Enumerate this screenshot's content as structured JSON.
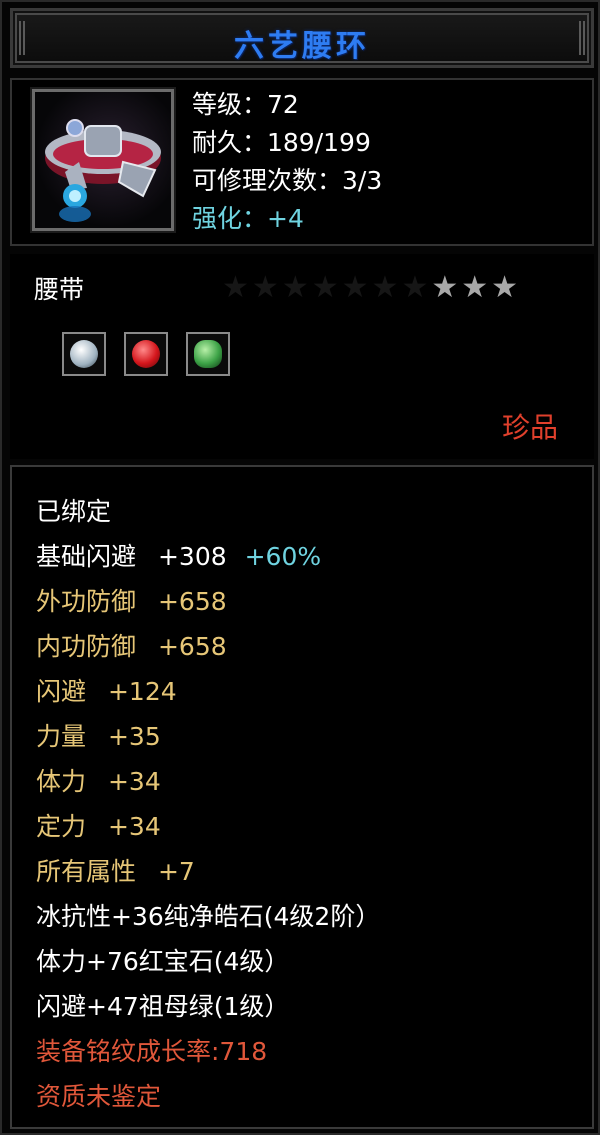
{
  "title": "六艺腰环",
  "info": {
    "level": "等级：72",
    "durability": "耐久：189/199",
    "repair": "可修理次数：3/3",
    "enhance": "强化：+4"
  },
  "item_type": "腰带",
  "stars": {
    "total": 10,
    "lit": 3
  },
  "gems": [
    {
      "name": "diamond-gem-icon",
      "color": "#d7e6f0"
    },
    {
      "name": "ruby-gem-icon",
      "color": "#d4161c"
    },
    {
      "name": "emerald-gem-icon",
      "color": "#3da347"
    }
  ],
  "rarity": "珍品",
  "attributes": {
    "bound": "已绑定",
    "base_dodge": {
      "label": "基础闪避",
      "value": "+308",
      "bonus": "+60%"
    },
    "ext_def": {
      "label": "外功防御",
      "value": "+658"
    },
    "int_def": {
      "label": "内功防御",
      "value": "+658"
    },
    "dodge": {
      "label": "闪避",
      "value": "+124"
    },
    "strength": {
      "label": "力量",
      "value": "+35"
    },
    "stamina": {
      "label": "体力",
      "value": "+34"
    },
    "focus": {
      "label": "定力",
      "value": "+34"
    },
    "all_attr": {
      "label": "所有属性",
      "value": "+7"
    },
    "gem1": "冰抗性+36纯净皓石(4级2阶）",
    "gem2": "体力+76红宝石(4级）",
    "gem3": "闪避+47祖母绿(1级）",
    "growth": "装备铭纹成长率:718",
    "aptitude": "资质未鉴定"
  }
}
